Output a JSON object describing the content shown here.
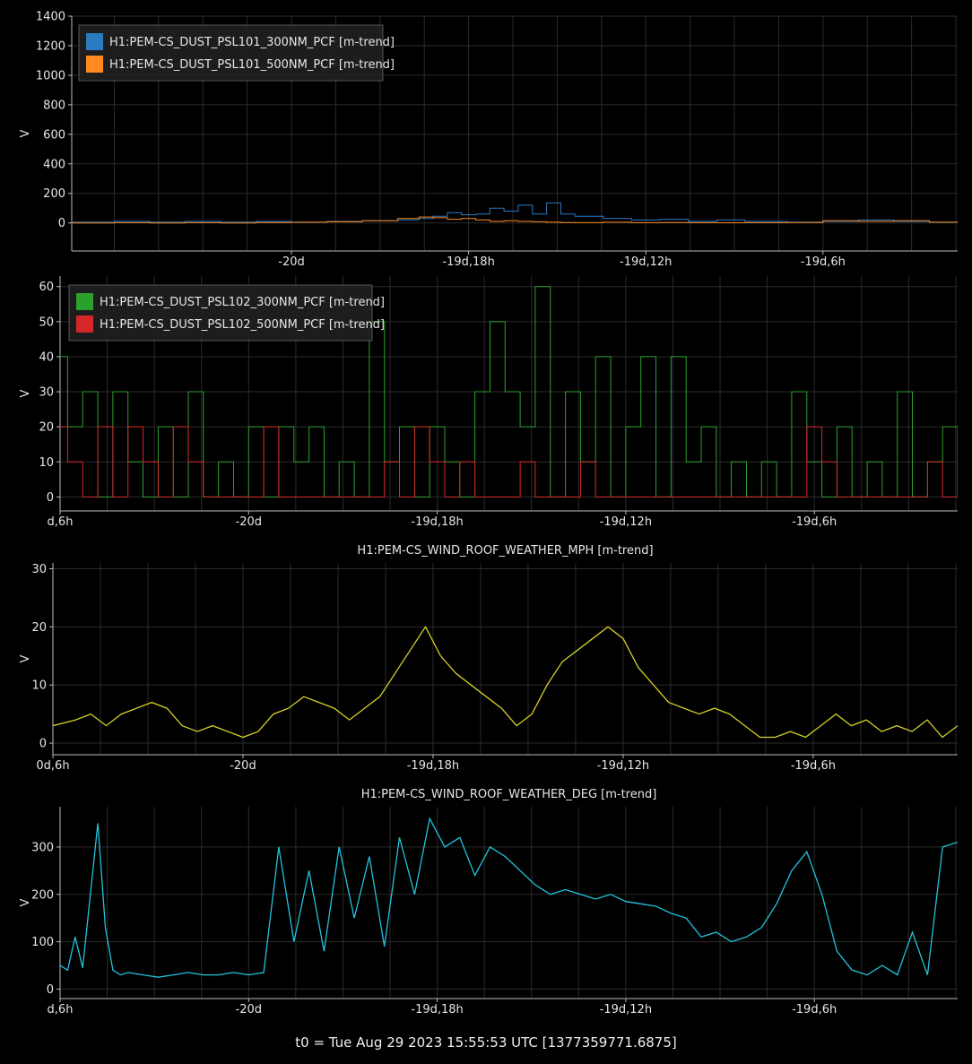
{
  "footer": "t0 = Tue Aug 29 2023 15:55:53 UTC [1377359771.6875]",
  "colors": {
    "background": "#000000",
    "grid": "#2b2b2b",
    "axis": "#bbbbbb",
    "text": "#e6e6e6",
    "legend_bg": "#1f1f1f",
    "legend_border": "#555555"
  },
  "chart_data": [
    {
      "type": "line",
      "title": "",
      "xlabel": "",
      "ylabel": "V",
      "xlim": [
        -20.31,
        -19.06
      ],
      "ylim": [
        -190,
        1400
      ],
      "x_ticks": [
        -20.0,
        -19.75,
        -19.5,
        -19.25
      ],
      "x_tick_labels": [
        "-20d",
        "-19d,18h",
        "-19d,12h",
        "-19d,6h"
      ],
      "y_ticks": [
        0,
        200,
        400,
        600,
        800,
        1000,
        1200,
        1400
      ],
      "y_tick_labels": [
        "0",
        "200",
        "400",
        "600",
        "800",
        "1000",
        "1200",
        "1400"
      ],
      "grid": true,
      "legend": "top-left",
      "series": [
        {
          "name": "H1:PEM-CS_DUST_PSL101_300NM_PCF [m-trend]",
          "color": "#2b7bc0",
          "x": [
            -20.31,
            -20.25,
            -20.2,
            -20.15,
            -20.1,
            -20.05,
            -20.0,
            -19.95,
            -19.9,
            -19.85,
            -19.82,
            -19.8,
            -19.78,
            -19.76,
            -19.74,
            -19.72,
            -19.7,
            -19.68,
            -19.66,
            -19.64,
            -19.62,
            -19.6,
            -19.56,
            -19.52,
            -19.48,
            -19.44,
            -19.4,
            -19.36,
            -19.3,
            -19.25,
            -19.2,
            -19.15,
            -19.1,
            -19.06
          ],
          "y": [
            5,
            10,
            5,
            10,
            5,
            10,
            5,
            10,
            15,
            20,
            30,
            45,
            70,
            55,
            60,
            100,
            80,
            120,
            60,
            135,
            60,
            45,
            30,
            20,
            25,
            10,
            20,
            10,
            5,
            10,
            20,
            10,
            5,
            5
          ]
        },
        {
          "name": "H1:PEM-CS_DUST_PSL101_500NM_PCF [m-trend]",
          "color": "#ff8a1f",
          "x": [
            -20.31,
            -20.25,
            -20.2,
            -20.15,
            -20.1,
            -20.05,
            -20.0,
            -19.95,
            -19.9,
            -19.85,
            -19.82,
            -19.8,
            -19.78,
            -19.76,
            -19.74,
            -19.72,
            -19.7,
            -19.68,
            -19.66,
            -19.64,
            -19.62,
            -19.6,
            -19.56,
            -19.52,
            -19.48,
            -19.44,
            -19.4,
            -19.36,
            -19.3,
            -19.25,
            -19.2,
            -19.15,
            -19.1,
            -19.06
          ],
          "y": [
            0,
            2,
            0,
            2,
            0,
            3,
            5,
            8,
            15,
            30,
            40,
            35,
            25,
            30,
            20,
            10,
            15,
            10,
            8,
            5,
            3,
            2,
            5,
            2,
            3,
            2,
            1,
            2,
            3,
            15,
            10,
            15,
            5,
            3
          ]
        }
      ]
    },
    {
      "type": "line",
      "title": "",
      "xlabel": "",
      "ylabel": "V",
      "xlim": [
        -20.25,
        -19.06
      ],
      "ylim": [
        -4,
        63
      ],
      "x_ticks": [
        -20.25,
        -20.0,
        -19.75,
        -19.5,
        -19.25
      ],
      "x_tick_labels": [
        "d,6h",
        "-20d",
        "-19d,18h",
        "-19d,12h",
        "-19d,6h"
      ],
      "y_ticks": [
        0,
        10,
        20,
        30,
        40,
        50,
        60
      ],
      "y_tick_labels": [
        "0",
        "10",
        "20",
        "30",
        "40",
        "50",
        "60"
      ],
      "grid": true,
      "legend": "top-left",
      "series": [
        {
          "name": "H1:PEM-CS_DUST_PSL102_300NM_PCF [m-trend]",
          "color": "#2ca02c",
          "x": [
            -20.25,
            -20.24,
            -20.22,
            -20.2,
            -20.18,
            -20.16,
            -20.14,
            -20.12,
            -20.1,
            -20.08,
            -20.06,
            -20.04,
            -20.02,
            -20.0,
            -19.98,
            -19.96,
            -19.94,
            -19.92,
            -19.9,
            -19.88,
            -19.86,
            -19.84,
            -19.82,
            -19.8,
            -19.78,
            -19.76,
            -19.74,
            -19.72,
            -19.7,
            -19.68,
            -19.66,
            -19.64,
            -19.62,
            -19.6,
            -19.58,
            -19.56,
            -19.54,
            -19.52,
            -19.5,
            -19.48,
            -19.46,
            -19.44,
            -19.42,
            -19.4,
            -19.38,
            -19.36,
            -19.34,
            -19.32,
            -19.3,
            -19.28,
            -19.26,
            -19.24,
            -19.22,
            -19.2,
            -19.18,
            -19.16,
            -19.14,
            -19.12,
            -19.1,
            -19.08,
            -19.06
          ],
          "y": [
            40,
            20,
            30,
            0,
            30,
            10,
            0,
            20,
            0,
            30,
            0,
            10,
            0,
            20,
            0,
            20,
            10,
            20,
            0,
            10,
            0,
            50,
            10,
            20,
            0,
            20,
            10,
            0,
            30,
            50,
            30,
            20,
            60,
            0,
            30,
            10,
            40,
            0,
            20,
            40,
            0,
            40,
            10,
            20,
            0,
            10,
            0,
            10,
            0,
            30,
            10,
            0,
            20,
            0,
            10,
            0,
            30,
            0,
            10,
            20,
            0
          ]
        },
        {
          "name": "H1:PEM-CS_DUST_PSL102_500NM_PCF [m-trend]",
          "color": "#d62728",
          "x": [
            -20.25,
            -20.24,
            -20.22,
            -20.2,
            -20.18,
            -20.16,
            -20.14,
            -20.12,
            -20.1,
            -20.08,
            -20.06,
            -20.04,
            -20.02,
            -20.0,
            -19.98,
            -19.96,
            -19.94,
            -19.92,
            -19.9,
            -19.88,
            -19.86,
            -19.84,
            -19.82,
            -19.8,
            -19.78,
            -19.76,
            -19.74,
            -19.72,
            -19.7,
            -19.68,
            -19.66,
            -19.64,
            -19.62,
            -19.6,
            -19.58,
            -19.56,
            -19.54,
            -19.52,
            -19.5,
            -19.48,
            -19.46,
            -19.44,
            -19.42,
            -19.4,
            -19.38,
            -19.36,
            -19.34,
            -19.32,
            -19.3,
            -19.28,
            -19.26,
            -19.24,
            -19.22,
            -19.2,
            -19.18,
            -19.16,
            -19.14,
            -19.12,
            -19.1,
            -19.08,
            -19.06
          ],
          "y": [
            20,
            10,
            0,
            20,
            0,
            20,
            10,
            0,
            20,
            10,
            0,
            0,
            0,
            0,
            20,
            0,
            0,
            0,
            0,
            0,
            0,
            0,
            10,
            0,
            20,
            10,
            0,
            10,
            0,
            0,
            0,
            10,
            0,
            0,
            0,
            10,
            0,
            0,
            0,
            0,
            0,
            0,
            0,
            0,
            0,
            0,
            0,
            0,
            0,
            0,
            20,
            10,
            0,
            0,
            0,
            0,
            0,
            0,
            10,
            0,
            0
          ]
        }
      ]
    },
    {
      "type": "line",
      "title": "H1:PEM-CS_WIND_ROOF_WEATHER_MPH [m-trend]",
      "xlabel": "",
      "ylabel": "V",
      "xlim": [
        -20.25,
        -19.06
      ],
      "ylim": [
        -2,
        31
      ],
      "x_ticks": [
        -20.25,
        -20.0,
        -19.75,
        -19.5,
        -19.25
      ],
      "x_tick_labels": [
        "0d,6h",
        "-20d",
        "-19d,18h",
        "-19d,12h",
        "-19d,6h"
      ],
      "y_ticks": [
        0,
        10,
        20,
        30
      ],
      "y_tick_labels": [
        "0",
        "10",
        "20",
        "30"
      ],
      "grid": true,
      "legend": "none",
      "series": [
        {
          "color": "#d4cf2a",
          "x": [
            -20.25,
            -20.22,
            -20.2,
            -20.18,
            -20.16,
            -20.14,
            -20.12,
            -20.1,
            -20.08,
            -20.06,
            -20.04,
            -20.02,
            -20.0,
            -19.98,
            -19.96,
            -19.94,
            -19.92,
            -19.9,
            -19.88,
            -19.86,
            -19.84,
            -19.82,
            -19.8,
            -19.78,
            -19.76,
            -19.74,
            -19.72,
            -19.7,
            -19.68,
            -19.66,
            -19.64,
            -19.62,
            -19.6,
            -19.58,
            -19.56,
            -19.54,
            -19.52,
            -19.5,
            -19.48,
            -19.46,
            -19.44,
            -19.42,
            -19.4,
            -19.38,
            -19.36,
            -19.34,
            -19.32,
            -19.3,
            -19.28,
            -19.26,
            -19.24,
            -19.22,
            -19.2,
            -19.18,
            -19.16,
            -19.14,
            -19.12,
            -19.1,
            -19.08,
            -19.06
          ],
          "y": [
            3,
            4,
            5,
            3,
            5,
            6,
            7,
            6,
            3,
            2,
            3,
            2,
            1,
            2,
            5,
            6,
            8,
            7,
            6,
            4,
            6,
            8,
            12,
            16,
            20,
            15,
            12,
            10,
            8,
            6,
            3,
            5,
            10,
            14,
            16,
            18,
            20,
            18,
            13,
            10,
            7,
            6,
            5,
            6,
            5,
            3,
            1,
            1,
            2,
            1,
            3,
            5,
            3,
            4,
            2,
            3,
            2,
            4,
            1,
            3
          ]
        }
      ]
    },
    {
      "type": "line",
      "title": "H1:PEM-CS_WIND_ROOF_WEATHER_DEG [m-trend]",
      "xlabel": "",
      "ylabel": "V",
      "xlim": [
        -20.25,
        -19.06
      ],
      "ylim": [
        -20,
        385
      ],
      "x_ticks": [
        -20.25,
        -20.0,
        -19.75,
        -19.5,
        -19.25
      ],
      "x_tick_labels": [
        "d,6h",
        "-20d",
        "-19d,18h",
        "-19d,12h",
        "-19d,6h"
      ],
      "y_ticks": [
        0,
        100,
        200,
        300
      ],
      "y_tick_labels": [
        "0",
        "100",
        "200",
        "300"
      ],
      "grid": true,
      "legend": "none",
      "series": [
        {
          "color": "#22c3dd",
          "x": [
            -20.25,
            -20.24,
            -20.23,
            -20.22,
            -20.2,
            -20.19,
            -20.18,
            -20.17,
            -20.16,
            -20.14,
            -20.12,
            -20.1,
            -20.08,
            -20.06,
            -20.04,
            -20.02,
            -20.0,
            -19.98,
            -19.96,
            -19.94,
            -19.92,
            -19.9,
            -19.88,
            -19.86,
            -19.84,
            -19.82,
            -19.8,
            -19.78,
            -19.76,
            -19.74,
            -19.72,
            -19.7,
            -19.68,
            -19.66,
            -19.64,
            -19.62,
            -19.6,
            -19.58,
            -19.56,
            -19.54,
            -19.52,
            -19.5,
            -19.48,
            -19.46,
            -19.44,
            -19.42,
            -19.4,
            -19.38,
            -19.36,
            -19.34,
            -19.32,
            -19.3,
            -19.28,
            -19.26,
            -19.24,
            -19.22,
            -19.2,
            -19.18,
            -19.16,
            -19.14,
            -19.12,
            -19.1,
            -19.08,
            -19.06
          ],
          "y": [
            50,
            40,
            110,
            45,
            350,
            130,
            40,
            30,
            35,
            30,
            25,
            30,
            35,
            30,
            30,
            35,
            30,
            35,
            300,
            100,
            250,
            80,
            300,
            150,
            280,
            90,
            320,
            200,
            360,
            300,
            320,
            240,
            300,
            280,
            250,
            220,
            200,
            210,
            200,
            190,
            200,
            185,
            180,
            175,
            160,
            150,
            110,
            120,
            100,
            110,
            130,
            180,
            250,
            290,
            200,
            80,
            40,
            30,
            50,
            30,
            120,
            30,
            300,
            310
          ]
        }
      ]
    }
  ]
}
